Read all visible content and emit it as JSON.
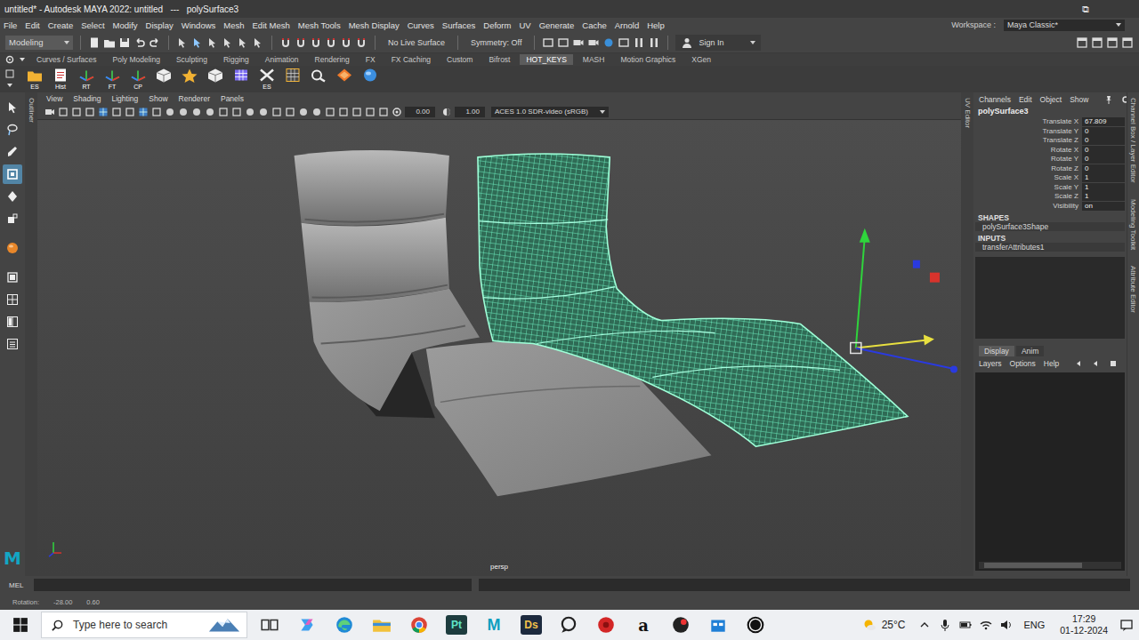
{
  "window": {
    "title": "untitled* - Autodesk MAYA 2022: untitled   ---   polySurface3",
    "controls": [
      "⧉"
    ]
  },
  "menu": [
    "File",
    "Edit",
    "Create",
    "Select",
    "Modify",
    "Display",
    "Windows",
    "Mesh",
    "Edit Mesh",
    "Mesh Tools",
    "Mesh Display",
    "Curves",
    "Surfaces",
    "Deform",
    "UV",
    "Generate",
    "Cache",
    "Arnold",
    "Help"
  ],
  "workspace": {
    "label": "Workspace :",
    "value": "Maya Classic*"
  },
  "status_line": {
    "mode": "Modeling",
    "live_surface": "No Live Surface",
    "symmetry": "Symmetry: Off",
    "sign_in": "Sign In"
  },
  "shelf_tabs": [
    {
      "label": "Curves / Surfaces",
      "selected": false
    },
    {
      "label": "Poly Modeling",
      "selected": false
    },
    {
      "label": "Sculpting",
      "selected": false
    },
    {
      "label": "Rigging",
      "selected": false
    },
    {
      "label": "Animation",
      "selected": false
    },
    {
      "label": "Rendering",
      "selected": false
    },
    {
      "label": "FX",
      "selected": false
    },
    {
      "label": "FX Caching",
      "selected": false
    },
    {
      "label": "Custom",
      "selected": false
    },
    {
      "label": "Bifrost",
      "selected": false
    },
    {
      "label": "HOT_KEYS",
      "selected": true
    },
    {
      "label": "MASH",
      "selected": false
    },
    {
      "label": "Motion Graphics",
      "selected": false
    },
    {
      "label": "XGen",
      "selected": false
    }
  ],
  "shelf_items": [
    {
      "kind": "folder",
      "label": "ES"
    },
    {
      "kind": "note",
      "label": "Hist"
    },
    {
      "kind": "axes",
      "label": "RT"
    },
    {
      "kind": "axes",
      "label": "FT"
    },
    {
      "kind": "axes",
      "label": "CP"
    },
    {
      "kind": "cube"
    },
    {
      "kind": "star"
    },
    {
      "kind": "cube"
    },
    {
      "kind": "mesh"
    },
    {
      "kind": "cross",
      "label": "ES"
    },
    {
      "kind": "grid"
    },
    {
      "kind": "tool"
    },
    {
      "kind": "diamond"
    },
    {
      "kind": "sphere"
    }
  ],
  "toolbox": [
    {
      "kind": "select",
      "selected": false
    },
    {
      "kind": "lasso",
      "selected": false
    },
    {
      "kind": "paint",
      "selected": false
    },
    {
      "kind": "move",
      "selected": true
    },
    {
      "kind": "rotate",
      "selected": false
    },
    {
      "kind": "scale",
      "selected": false
    },
    {
      "kind": "sphere",
      "selected": false
    },
    {
      "kind": "layout-single",
      "selected": false
    },
    {
      "kind": "layout-four",
      "selected": false
    },
    {
      "kind": "layout-two",
      "selected": false
    },
    {
      "kind": "outliner",
      "selected": false
    }
  ],
  "logo": "M",
  "left_tabs": [
    "Outliner"
  ],
  "uv_tab": "UV Editor",
  "viewport": {
    "menu": [
      "View",
      "Shading",
      "Lighting",
      "Show",
      "Renderer",
      "Panels"
    ],
    "exposure": "0.00",
    "gamma": "1.00",
    "color_space": "ACES 1.0 SDR-video (sRGB)",
    "camera": "persp"
  },
  "channel_box": {
    "menu": [
      "Channels",
      "Edit",
      "Object",
      "Show"
    ],
    "object": "polySurface3",
    "attributes": [
      {
        "name": "Translate X",
        "value": "67.809"
      },
      {
        "name": "Translate Y",
        "value": "0"
      },
      {
        "name": "Translate Z",
        "value": "0"
      },
      {
        "name": "Rotate X",
        "value": "0"
      },
      {
        "name": "Rotate Y",
        "value": "0"
      },
      {
        "name": "Rotate Z",
        "value": "0"
      },
      {
        "name": "Scale X",
        "value": "1"
      },
      {
        "name": "Scale Y",
        "value": "1"
      },
      {
        "name": "Scale Z",
        "value": "1"
      },
      {
        "name": "Visibility",
        "value": "on"
      }
    ],
    "shapes_header": "SHAPES",
    "shape": "polySurface3Shape",
    "inputs_header": "INPUTS",
    "input": "transferAttributes1"
  },
  "layer_editor": {
    "tabs": [
      {
        "label": "Display",
        "selected": true
      },
      {
        "label": "Anim",
        "selected": false
      }
    ],
    "menu": [
      "Layers",
      "Options",
      "Help"
    ]
  },
  "side_tabs": [
    "Channel Box / Layer Editor",
    "Modeling Toolkit",
    "Attribute Editor"
  ],
  "command_line": {
    "language": "MEL"
  },
  "help_line": {
    "label": "Rotation:",
    "values": [
      "-28.00",
      "0.60"
    ]
  },
  "taskbar": {
    "search_placeholder": "Type here to search",
    "apps": [
      {
        "kind": "taskview"
      },
      {
        "kind": "copilot"
      },
      {
        "kind": "edge"
      },
      {
        "kind": "explorer"
      },
      {
        "kind": "chrome"
      },
      {
        "kind": "painter",
        "label": "Pt"
      },
      {
        "kind": "maya",
        "label": "M"
      },
      {
        "kind": "designer",
        "label": "Ds"
      },
      {
        "kind": "bubble"
      },
      {
        "kind": "red"
      },
      {
        "kind": "amazon",
        "label": "a"
      },
      {
        "kind": "recorder"
      },
      {
        "kind": "store"
      },
      {
        "kind": "unreal"
      }
    ],
    "weather": "25°C",
    "language": "ENG",
    "time": "17:29",
    "date": "01-12-2024"
  }
}
